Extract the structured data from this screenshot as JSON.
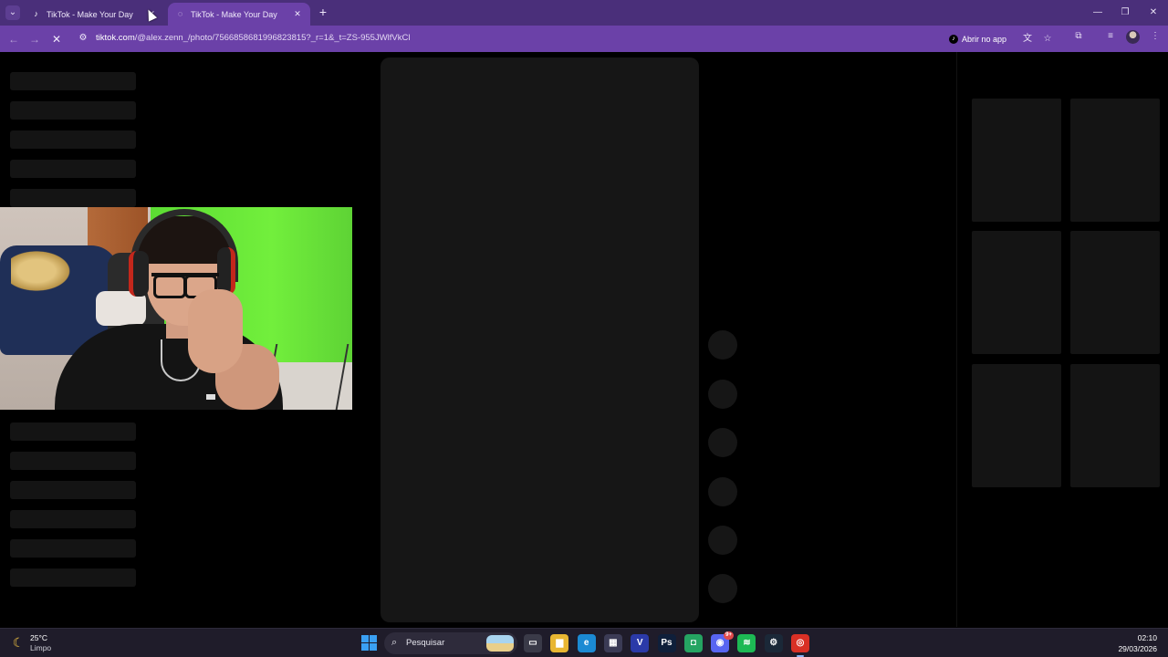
{
  "browser": {
    "tabs": [
      {
        "title": "TikTok - Make Your Day",
        "close": "✕",
        "active": false
      },
      {
        "title": "TikTok - Make Your Day",
        "close": "✕",
        "active": true
      }
    ],
    "tab_list_icon": "chevron-down-icon",
    "new_tab": "+",
    "window_controls": {
      "minimize": "—",
      "maximize": "❐",
      "close": "✕"
    },
    "url_host": "tiktok.com",
    "url_path": "/@alex.zenn_/photo/7566858681996823815?_r=1&_t=ZS-955JWlfVkCl",
    "open_in_app": "Abrir no app",
    "toolbar_icons": [
      "translate-icon",
      "star-icon",
      "extensions-icon",
      "media-icon",
      "profile-avatar",
      "menu-icon"
    ]
  },
  "taskbar": {
    "weather_temp": "25°C",
    "weather_desc": "Limpo",
    "search_placeholder": "Pesquisar",
    "apps": [
      {
        "name": "task-view",
        "glyph": "▭",
        "color": "#3a3a48"
      },
      {
        "name": "file-explorer",
        "glyph": "▆",
        "color": "#e8b632"
      },
      {
        "name": "edge",
        "glyph": "e",
        "color": "#1b8ad3"
      },
      {
        "name": "microsoft-store",
        "glyph": "▦",
        "color": "#3b3b55"
      },
      {
        "name": "vegas",
        "glyph": "V",
        "color": "#2b3aa8"
      },
      {
        "name": "photoshop",
        "glyph": "Ps",
        "color": "#0f1f3a"
      },
      {
        "name": "whatsapp-like",
        "glyph": "◘",
        "color": "#25a462"
      },
      {
        "name": "discord",
        "glyph": "◉",
        "color": "#5865f2",
        "badge": "9+"
      },
      {
        "name": "spotify",
        "glyph": "≋",
        "color": "#1db954"
      },
      {
        "name": "steam",
        "glyph": "⚙",
        "color": "#1b2838"
      },
      {
        "name": "chrome",
        "glyph": "◎",
        "color": "#d93025",
        "active": true
      }
    ],
    "clock_time": "02:10",
    "clock_date": "29/03/2026"
  },
  "colors": {
    "accent_purple": "#6b41a8",
    "titlebar_purple": "#4a2f7a",
    "skeleton": "#141414",
    "taskbar": "#1f1c2a"
  }
}
